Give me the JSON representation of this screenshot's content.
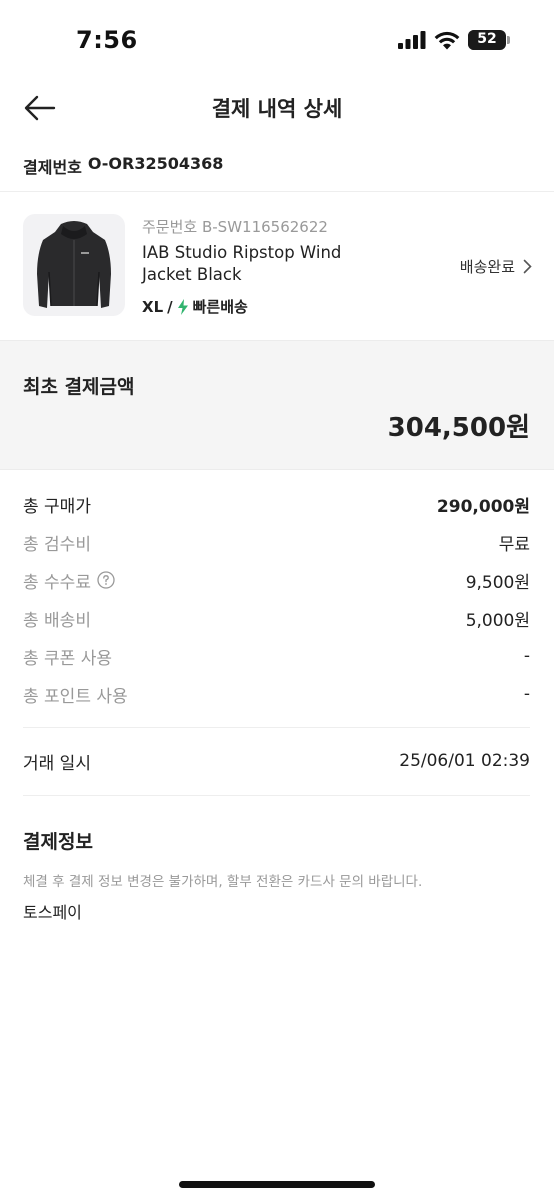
{
  "status_bar": {
    "time": "7:56",
    "battery": "52",
    "battery_level": 0.52
  },
  "header": {
    "title": "결제 내역 상세",
    "back_icon": "arrow-left-icon"
  },
  "payment": {
    "label": "결제번호",
    "number": "O-OR32504368"
  },
  "product": {
    "order_number": "주문번호 B-SW116562622",
    "name_line1": "IAB Studio Ripstop Wind",
    "name_line2": "Jacket Black",
    "size": "XL",
    "separator": "/",
    "shipping_type": "빠른배송",
    "shipping_icon": "lightning-bolt-icon",
    "status": "배송완료",
    "status_icon": "chevron-right-icon"
  },
  "initial_payment": {
    "label": "최초 결제금액",
    "amount": "304,500원"
  },
  "breakdown": [
    {
      "label": "총 구매가",
      "value": "290,000원"
    },
    {
      "label": "총 검수비",
      "value": "무료"
    },
    {
      "label": "총 수수료",
      "value": "9,500원"
    },
    {
      "label": "총 배송비",
      "value": "5,000원"
    },
    {
      "label": "총 쿠폰 사용",
      "value": "-"
    },
    {
      "label": "총 포인트 사용",
      "value": "-"
    }
  ],
  "transaction": {
    "label": "거래 일시",
    "value": "25/06/01 02:39"
  },
  "payment_info": {
    "title": "결제정보",
    "notice": "체결 후 결제 정보 변경은 불가하며, 할부 전환은 카드사 문의 바랍니다.",
    "method": "토스페이"
  },
  "colors": {
    "background": "#ffffff",
    "text": "#222222",
    "muted": "#999999",
    "box": "#f5f5f5",
    "bolt": "#31b46e"
  }
}
